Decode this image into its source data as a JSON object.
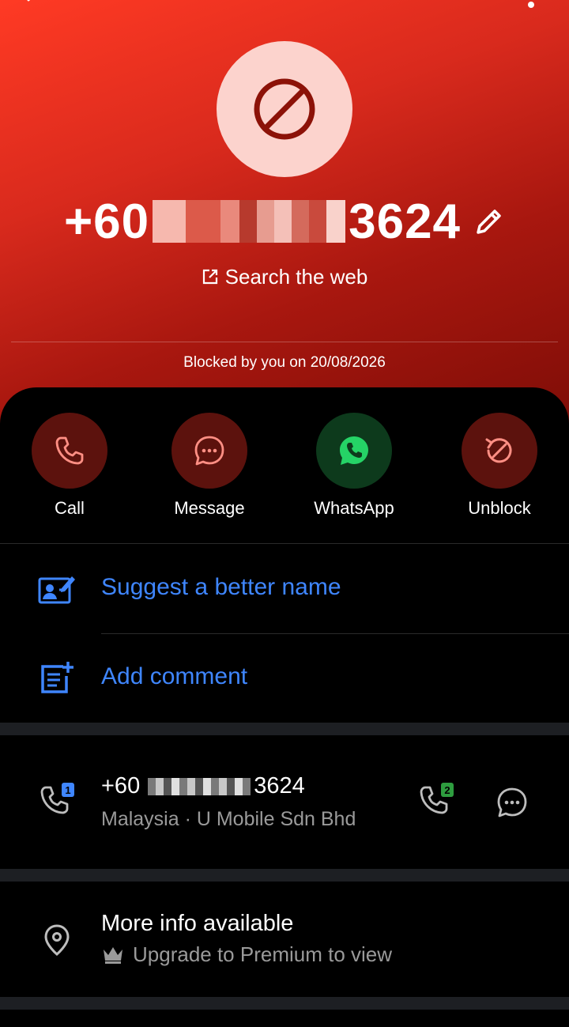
{
  "header": {
    "number_prefix": "+60",
    "number_suffix": "3624",
    "search_web": "Search the web",
    "blocked_status": "Blocked by you on 20/08/2026"
  },
  "actions": [
    {
      "label": "Call",
      "icon": "phone-icon"
    },
    {
      "label": "Message",
      "icon": "chat-bubble-icon"
    },
    {
      "label": "WhatsApp",
      "icon": "whatsapp-icon"
    },
    {
      "label": "Unblock",
      "icon": "unblock-icon"
    }
  ],
  "options": {
    "suggest_name": "Suggest a better name",
    "add_comment": "Add comment"
  },
  "phone_entry": {
    "number_prefix": "+60",
    "number_suffix": "3624",
    "details": "Malaysia · U Mobile Sdn Bhd",
    "sim1_badge": "1",
    "sim2_badge": "2"
  },
  "more_info": {
    "title": "More info available",
    "subtitle": "Upgrade to Premium to view"
  },
  "colors": {
    "accent_blue": "#3f86ff",
    "hero_red": "#d92a1d",
    "action_red_bg": "#5c120d",
    "whatsapp_green_bg": "#0d3a1c",
    "whatsapp_green": "#25d366"
  }
}
